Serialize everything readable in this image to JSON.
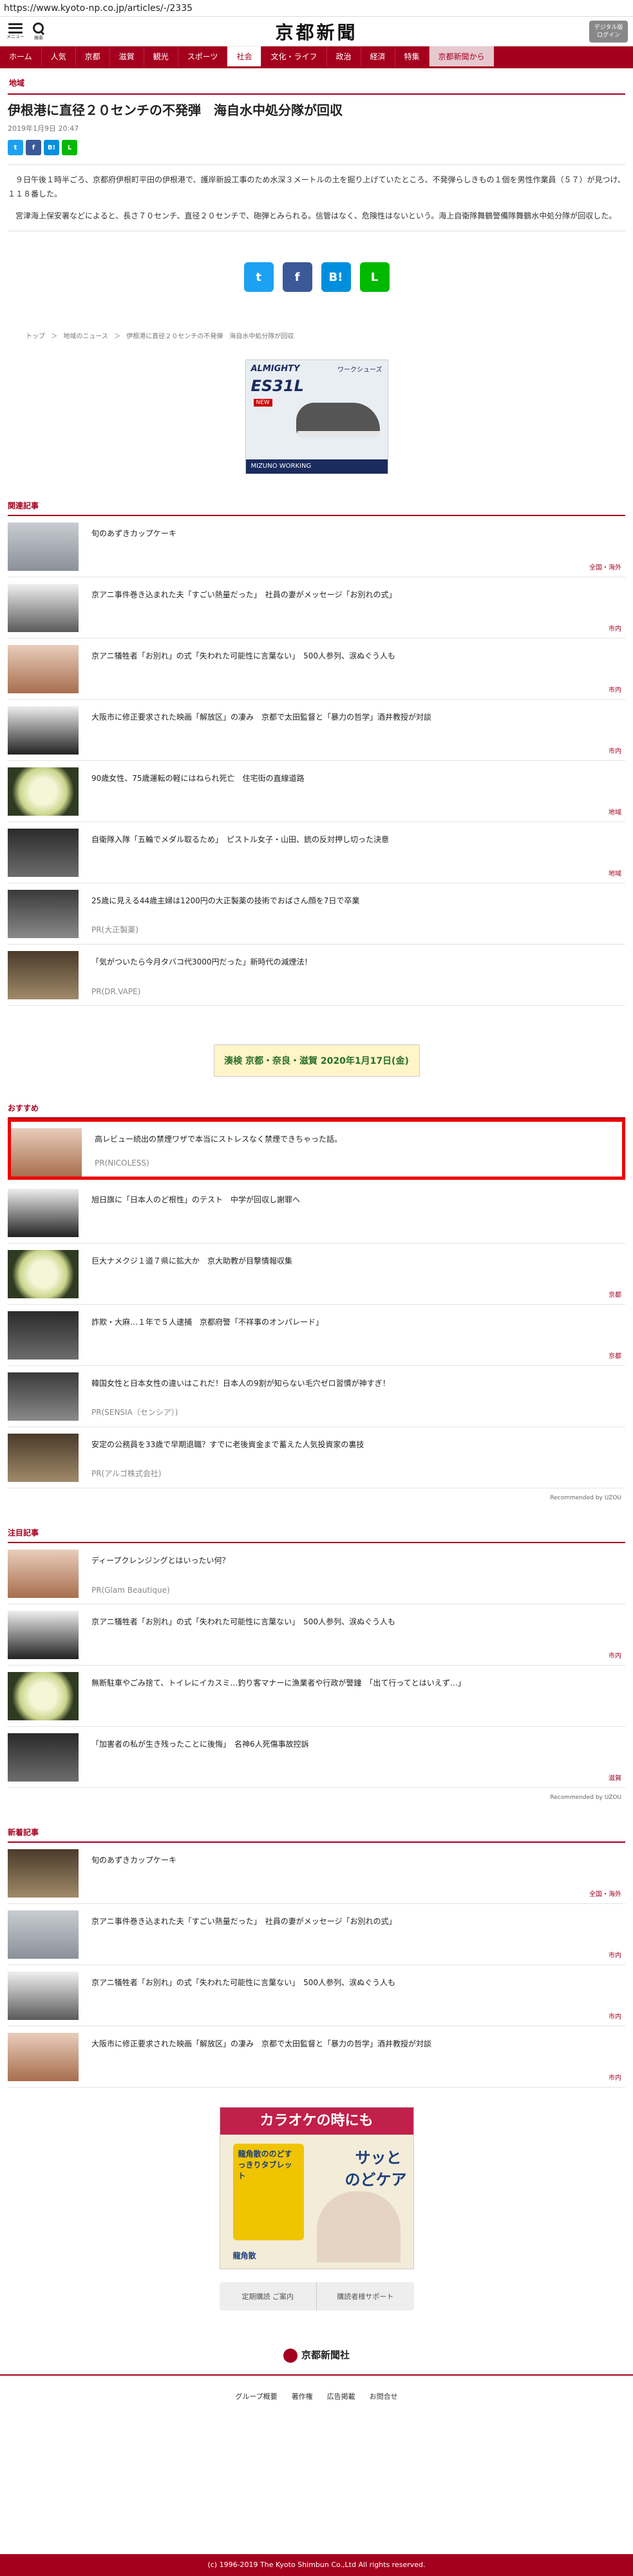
{
  "url": "https://www.kyoto-np.co.jp/articles/-/2335",
  "header": {
    "menu_label": "メニュー",
    "search_label": "検索",
    "logo": "京都新聞",
    "login_line1": "デジタル版",
    "login_line2": "ログイン"
  },
  "nav": [
    "ホーム",
    "人気",
    "京都",
    "滋賀",
    "観光",
    "スポーツ",
    "社会",
    "文化・ライフ",
    "政治",
    "経済",
    "特集",
    "京都新聞から"
  ],
  "nav_active": "社会",
  "article": {
    "section": "地域",
    "title": "伊根港に直径２０センチの不発弾　海自水中処分隊が回収",
    "date": "2019年1月9日 20:47",
    "paragraphs": [
      "９日午後１時半ごろ、京都府伊根町平田の伊根港で、護岸新設工事のため水深３メートルの土を掘り上げていたところ、不発弾らしきもの１個を男性作業員（５７）が見つけ、１１８番した。",
      "宮津海上保安署などによると、長さ７０センチ、直径２０センチで、砲弾とみられる。信管はなく、危険性はないという。海上自衛隊舞鶴警備隊舞鶴水中処分隊が回収した。"
    ]
  },
  "share_icons": [
    "twitter-icon",
    "facebook-icon",
    "hatena-icon",
    "line-icon"
  ],
  "breadcrumbs": [
    "トップ",
    "＞",
    "地域のニュース",
    "＞",
    "伊根港に直径２０センチの不発弾　海自水中処分隊が回収"
  ],
  "ad1": {
    "brand": "ALMIGHTY",
    "model": "ES31L",
    "sub": "ワークシューズ",
    "maker": "MIZUNO WORKING",
    "badge": "NEW"
  },
  "related": {
    "title": "関連記事",
    "items": [
      {
        "text": "旬のあずきカップケーキ",
        "tag": "全国・海外"
      },
      {
        "text": "京アニ事件巻き込まれた夫「すごい熱量だった」　社員の妻がメッセージ「お別れの式」",
        "tag": "市内"
      },
      {
        "text": "京アニ犠牲者「お別れ」の式「失われた可能性に言葉ない」　500人参列、涙ぬぐう人も",
        "tag": "市内"
      },
      {
        "text": "大阪市に修正要求された映画「解放区」の凄み　京都で太田監督と「暴力の哲学」酒井教授が対談",
        "tag": "市内"
      },
      {
        "text": "90歳女性、75歳運転の軽にはねられ死亡　住宅街の直線道路",
        "tag": "地域"
      },
      {
        "text": "自衛隊入隊「五輪でメダル取るため」　ピストル女子・山田、銃の反対押し切った決意",
        "tag": "地域"
      },
      {
        "text": "25歳に見える44歳主婦は1200円の大正製薬の技術でおばさん顔を7日で卒業",
        "pr": "PR(大正製薬)"
      },
      {
        "text": "「気がついたら今月タバコ代3000円だった」新時代の減煙法！",
        "pr": "PR(DR.VAPE)"
      }
    ]
  },
  "ad2": {
    "text": "湊検 京都・奈良・滋賀 2020年1月17日(金)"
  },
  "recommend": {
    "title": "おすすめ",
    "items": [
      {
        "text": "高レビュー続出の禁煙ワザで本当にストレスなく禁煙できちゃった話。",
        "pr": "PR(NICOLESS)"
      },
      {
        "text": "旭日旗に「日本人のど根性」のテスト　中学が回収し謝罪へ",
        "tag": ""
      },
      {
        "text": "巨大ナメクジ１道７県に拡大か　京大助教が目撃情報収集",
        "tag": "京都"
      },
      {
        "text": "詐欺・大麻…１年で５人逮捕　京都府警「不祥事のオンパレード」",
        "tag": "京都"
      },
      {
        "text": "韓国女性と日本女性の違いはこれだ！日本人の9割が知らない毛穴ゼロ習慣が神すぎ！",
        "pr": "PR(SENSIA（センシア）)"
      },
      {
        "text": "安定の公務員を33歳で早期退職？すでに老後資金まで蓄えた人気投資家の裏技",
        "pr": "PR(アルゴ株式会社)"
      }
    ],
    "by": "Recommended by UZOU"
  },
  "attention": {
    "title": "注目記事",
    "items": [
      {
        "text": "ディープクレンジングとはいったい何？",
        "pr": "PR(Glam Beautique)"
      },
      {
        "text": "京アニ犠牲者「お別れ」の式「失われた可能性に言葉ない」　500人参列、涙ぬぐう人も",
        "tag": "市内"
      },
      {
        "text": "無断駐車やごみ捨て、トイレにイカスミ…釣り客マナーに漁業者や行政が警鐘　「出て行ってとはいえず…」",
        "tag": ""
      },
      {
        "text": "「加害者の私が生き残ったことに後悔」　名神6人死傷事故控訴",
        "tag": "滋賀"
      }
    ],
    "by": "Recommended by UZOU"
  },
  "latest": {
    "title": "新着記事",
    "items": [
      {
        "text": "旬のあずきカップケーキ",
        "tag": "全国・海外"
      },
      {
        "text": "京アニ事件巻き込まれた夫「すごい熱量だった」　社員の妻がメッセージ「お別れの式」",
        "tag": "市内"
      },
      {
        "text": "京アニ犠牲者「お別れ」の式「失われた可能性に言葉ない」　500人参列、涙ぬぐう人も",
        "tag": "市内"
      },
      {
        "text": "大阪市に修正要求された映画「解放区」の凄み　京都で太田監督と「暴力の哲学」酒井教授が対談",
        "tag": "市内"
      }
    ]
  },
  "ad3": {
    "head": "カラオケの時にも",
    "sub1": "サッと",
    "sub2": "のどケア",
    "product": "龍角散ののどすっきりタブレット",
    "maker": "龍角散"
  },
  "promo": [
    "定期購読 ご案内",
    "購読者様サポート"
  ],
  "footer": {
    "logo": "京都新聞社",
    "links": [
      "グループ概要",
      "著作権",
      "広告掲載",
      "お問合せ"
    ],
    "copyright": "(c) 1996-2019 The Kyoto Shimbun Co.,Ltd All rights reserved."
  },
  "colors": {
    "brand": "#a4001e",
    "twitter": "#1da1f2",
    "facebook": "#3b5998",
    "hatena": "#008fde",
    "line": "#00b900"
  }
}
